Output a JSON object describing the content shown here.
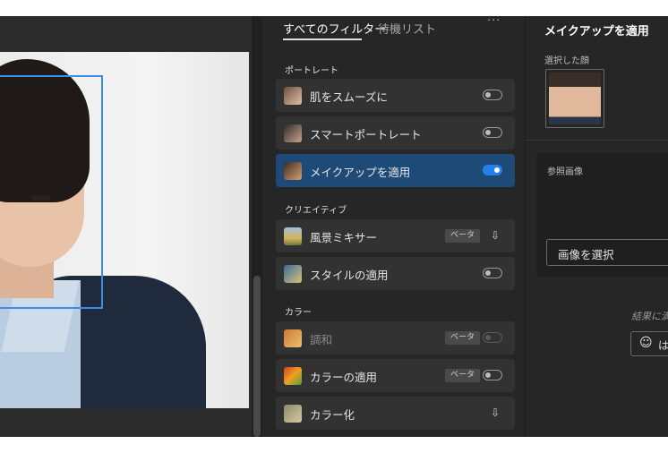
{
  "filters_panel": {
    "tabs": [
      {
        "label": "すべてのフィルター",
        "active": true
      },
      {
        "label": "待機リスト",
        "active": false
      }
    ],
    "more_label": "···",
    "sections": {
      "portrait": "ポートレート",
      "creative": "クリエイティブ",
      "color": "カラー"
    },
    "items": [
      {
        "label": "肌をスムーズに",
        "control": "toggle-off",
        "icon": "face-thumb-icon"
      },
      {
        "label": "スマートポートレート",
        "control": "toggle-off",
        "icon": "face-thumb-icon"
      },
      {
        "label": "メイクアップを適用",
        "control": "toggle-on",
        "selected": true,
        "icon": "face-thumb-icon"
      },
      {
        "label": "風景ミキサー",
        "badge": "ベータ",
        "control": "cloud-download",
        "icon": "landscape-thumb-icon"
      },
      {
        "label": "スタイルの適用",
        "control": "toggle-off",
        "icon": "style-thumb-icon"
      },
      {
        "label": "調和",
        "badge": "ベータ",
        "control": "toggle-off-disabled",
        "dim": true,
        "icon": "harmony-thumb-icon"
      },
      {
        "label": "カラーの適用",
        "badge": "ベータ",
        "control": "toggle-off",
        "icon": "color-transfer-thumb-icon"
      },
      {
        "label": "カラー化",
        "control": "cloud-download",
        "icon": "colorize-thumb-icon"
      }
    ],
    "cloud_glyph": "⇩"
  },
  "settings_panel": {
    "title": "メイクアップを適用",
    "selected_face_label": "選択した顔",
    "reference_label": "参照画像",
    "select_image_label": "画像を選択",
    "result_note": "結果に満",
    "feedback_smile": "☺",
    "feedback_label": "は"
  },
  "colors": {
    "accent": "#2680eb",
    "selected_row": "#1e4a78",
    "face_box": "#3a8ee6",
    "panel_bg": "#262626",
    "row_bg": "#323232"
  }
}
